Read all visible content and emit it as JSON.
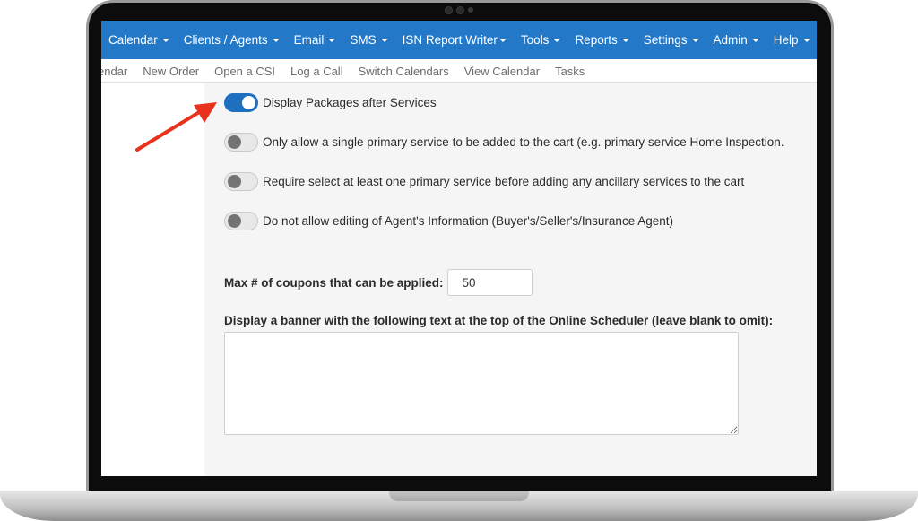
{
  "nav": {
    "items": [
      {
        "label": "Calendar"
      },
      {
        "label": "Clients / Agents"
      },
      {
        "label": "Email"
      },
      {
        "label": "SMS"
      },
      {
        "label": "ISN Report Writer"
      },
      {
        "label": "Tools"
      },
      {
        "label": "Reports"
      },
      {
        "label": "Settings"
      },
      {
        "label": "Admin"
      },
      {
        "label": "Help"
      }
    ]
  },
  "subnav": {
    "items": [
      {
        "label": "endar"
      },
      {
        "label": "New Order"
      },
      {
        "label": "Open a CSI"
      },
      {
        "label": "Log a Call"
      },
      {
        "label": "Switch Calendars"
      },
      {
        "label": "View Calendar"
      },
      {
        "label": "Tasks"
      }
    ]
  },
  "options": [
    {
      "label": "Display Packages after Services",
      "enabled": true
    },
    {
      "label": "Only allow a single primary service to be added to the cart (e.g. primary service Home Inspection.",
      "enabled": false
    },
    {
      "label": "Require select at least one primary service before adding any ancillary services to the cart",
      "enabled": false
    },
    {
      "label": "Do not allow editing of Agent's Information (Buyer's/Seller's/Insurance Agent)",
      "enabled": false
    }
  ],
  "coupons": {
    "label": "Max # of coupons that can be applied:",
    "value": "50"
  },
  "banner": {
    "label": "Display a banner with the following text at the top of the Online Scheduler (leave blank to omit):",
    "value": ""
  },
  "colors": {
    "nav_bg": "#2378c8",
    "toggle_on": "#1f6fbf",
    "arrow": "#e8321e"
  }
}
